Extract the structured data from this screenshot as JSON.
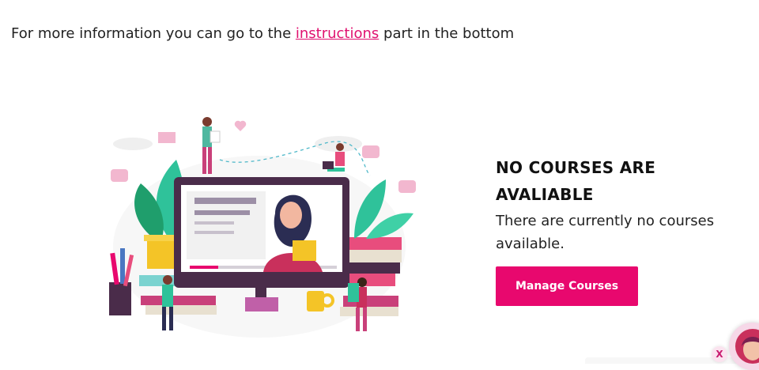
{
  "info": {
    "prefix": "For more information you can go to the ",
    "link_text": "instructions",
    "suffix": " part in the bottom"
  },
  "empty_state": {
    "title": "NO COURSES ARE AVALIABLE",
    "text": "There are currently no courses available.",
    "button_label": "Manage Courses"
  },
  "chat": {
    "close_label": "X"
  },
  "colors": {
    "accent": "#e8086e",
    "link": "#e0106f"
  }
}
